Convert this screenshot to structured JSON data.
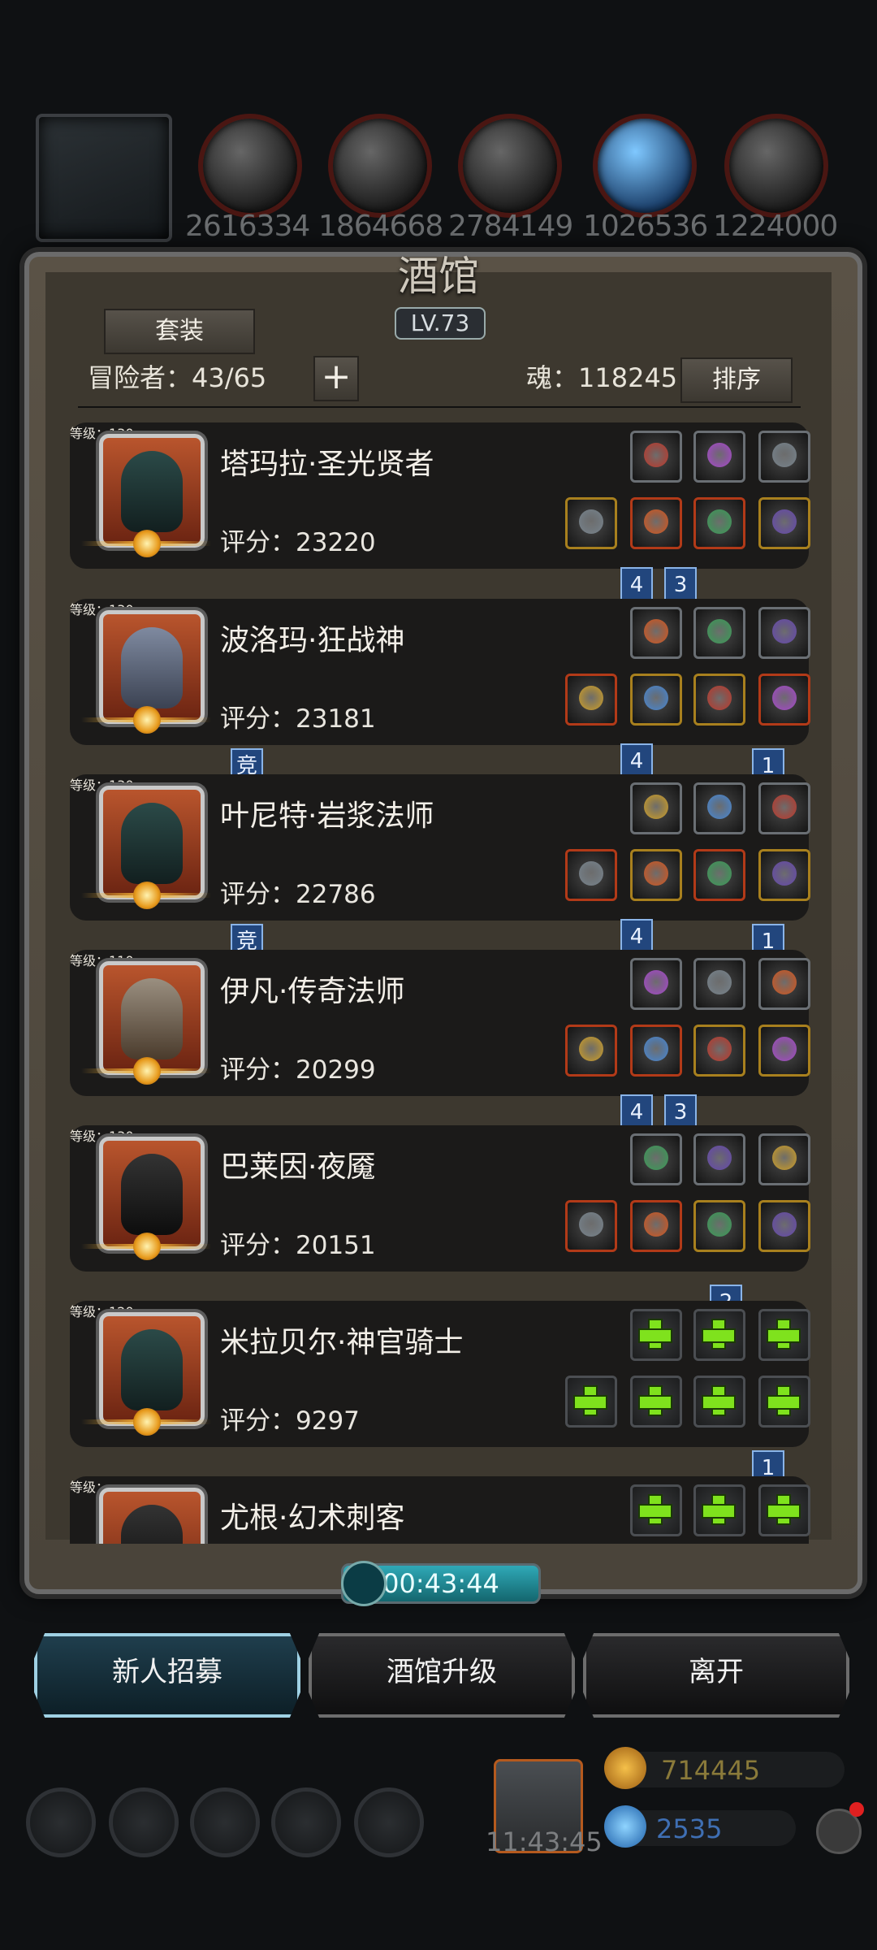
{
  "resources": {
    "values": [
      "2616334",
      "1864668",
      "2784149",
      "1026536",
      "1224000"
    ],
    "icons": [
      "ore-icon",
      "wood-icon",
      "stone-icon",
      "crystal-icon",
      "iron-icon"
    ]
  },
  "tavern": {
    "title": "酒馆",
    "level": "LV.73",
    "suit_button": "套装",
    "adventurer_label": "冒险者：43/65",
    "soul_label": "魂：118245",
    "sort_button": "排序"
  },
  "heroes": [
    {
      "name": "塔玛拉·圣光贤者",
      "level": "等级：130",
      "score": "评分：23220",
      "face": "hood",
      "top_slots": [
        "gear",
        "gem",
        "gear"
      ],
      "bottom_slots": [
        "gold",
        "red",
        "red",
        "gold"
      ],
      "tags": [
        {
          "text": "4",
          "pos": "a"
        },
        {
          "text": "3",
          "pos": "b"
        }
      ]
    },
    {
      "name": "波洛玛·狂战神",
      "level": "等级：130",
      "score": "评分：23181",
      "face": "beast",
      "top_slots": [
        "gear",
        "gear",
        "gear"
      ],
      "bottom_slots": [
        "red",
        "gold",
        "gold",
        "red"
      ],
      "tags": [
        {
          "text": "竞",
          "pos": "c"
        },
        {
          "text": "4",
          "pos": "a"
        },
        {
          "text": "1",
          "pos": "d"
        }
      ]
    },
    {
      "name": "叶尼特·岩浆法师",
      "level": "等级：130",
      "score": "评分：22786",
      "face": "hood",
      "top_slots": [
        "gear",
        "gear",
        "gear"
      ],
      "bottom_slots": [
        "red",
        "gold",
        "red",
        "gold"
      ],
      "tags": [
        {
          "text": "竞",
          "pos": "c"
        },
        {
          "text": "4",
          "pos": "a"
        },
        {
          "text": "1",
          "pos": "d"
        }
      ]
    },
    {
      "name": "伊凡·传奇法师",
      "level": "等级：110",
      "score": "评分：20299",
      "face": "elder",
      "top_slots": [
        "gear",
        "gear",
        "gear"
      ],
      "bottom_slots": [
        "red",
        "red",
        "gold",
        "gold"
      ],
      "tags": [
        {
          "text": "4",
          "pos": "a"
        },
        {
          "text": "3",
          "pos": "b"
        }
      ]
    },
    {
      "name": "巴莱因·夜魇",
      "level": "等级：130",
      "score": "评分：20151",
      "face": "ninja",
      "top_slots": [
        "gear",
        "gear",
        "gear"
      ],
      "bottom_slots": [
        "red",
        "red",
        "gold",
        "gold"
      ],
      "tags": [
        {
          "text": "2",
          "pos": "e"
        }
      ]
    },
    {
      "name": "米拉贝尔·神官骑士",
      "level": "等级：120",
      "score": "评分：9297",
      "face": "hood",
      "top_slots": [
        "plus",
        "plus",
        "plus"
      ],
      "bottom_slots": [
        "plus",
        "plus",
        "plus",
        "plus"
      ],
      "tags": [
        {
          "text": "1",
          "pos": "d"
        }
      ]
    },
    {
      "name": "尤根·幻术刺客",
      "level": "等级：",
      "score": "",
      "face": "ninja",
      "top_slots": [
        "plus",
        "plus",
        "plus"
      ],
      "bottom_slots": [],
      "tags": []
    }
  ],
  "timer": "00:43:44",
  "actions": {
    "recruit": "新人招募",
    "upgrade": "酒馆升级",
    "leave": "离开"
  },
  "bottom": {
    "clock": "11:43:45",
    "gold": "714445",
    "gems": "2535"
  },
  "colors": {
    "gold_text": "#8a7a3a",
    "gem_text": "#3f6fb3",
    "tag_blue": "#22467d"
  }
}
